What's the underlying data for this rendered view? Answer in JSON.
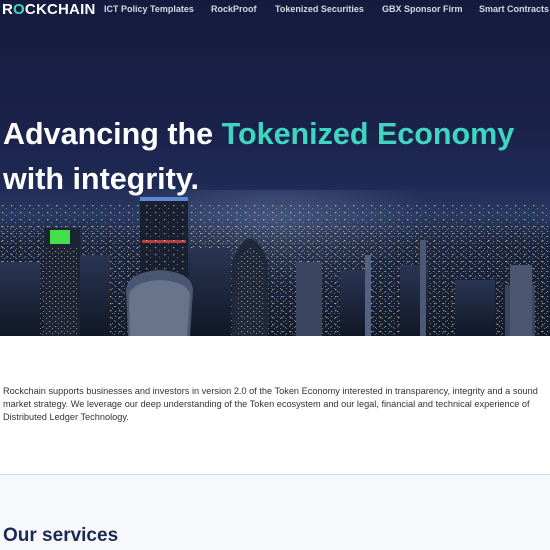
{
  "brand": {
    "logo_text_before": "R",
    "logo_text_o": "O",
    "logo_text_after": "CKCHAIN",
    "accent_color": "#3ed6c0",
    "navy_color": "#1b2a55"
  },
  "nav": {
    "items": [
      {
        "label": "ICT Policy Templates"
      },
      {
        "label": "RockProof"
      },
      {
        "label": "Tokenized Securities"
      },
      {
        "label": "GBX Sponsor Firm"
      },
      {
        "label": "Smart Contracts"
      }
    ]
  },
  "hero": {
    "headline_part1": "Advancing the ",
    "headline_accent": "Tokenized Economy",
    "headline_line2": "with integrity."
  },
  "intro": {
    "text": "Rockchain supports businesses and investors in version 2.0 of the Token Economy interested in transparency, integrity and a sound market strategy. We leverage our deep understanding of the Token ecosystem and our legal, financial and technical experience of Distributed Ledger Technology."
  },
  "services": {
    "title": "Our services"
  }
}
